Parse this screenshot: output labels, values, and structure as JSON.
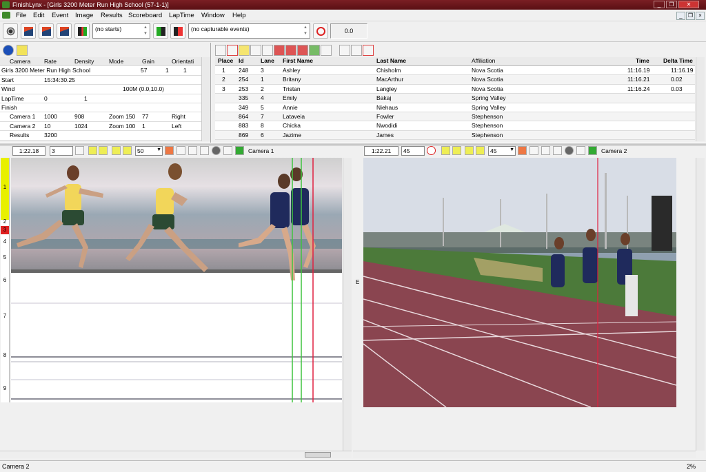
{
  "window": {
    "title": "FinishLynx - [Girls 3200 Meter Run High School (57-1-1)]"
  },
  "menu": [
    "File",
    "Edit",
    "Event",
    "Image",
    "Results",
    "Scoreboard",
    "LapTime",
    "Window",
    "Help"
  ],
  "toolbar": {
    "start_combo": "(no starts)",
    "event_combo": "(no capturable events)",
    "time_display": "0.0"
  },
  "info": {
    "headers": [
      "Camera",
      "Rate",
      "Density",
      "Mode",
      "Gain",
      "Orientati"
    ],
    "event_name": "Girls 3200 Meter Run High School",
    "event_nums": [
      "57",
      "1",
      "1"
    ],
    "start_label": "Start",
    "start_value": "15:34:30.25",
    "wind_label": "Wind",
    "wind_value": "100M (0.0,10.0)",
    "laptime_label": "LapTime",
    "laptime_values": [
      "0",
      "1"
    ],
    "finish_label": "Finish",
    "cameras": [
      {
        "name": "Camera 1",
        "rate": "1000",
        "density": "908",
        "mode": "Zoom 150",
        "gain": "77",
        "orientation": "Right"
      },
      {
        "name": "Camera 2",
        "rate": "10",
        "density": "1024",
        "mode": "Zoom 100",
        "gain": "1",
        "orientation": "Left"
      }
    ],
    "results_label": "Results",
    "results_value": "3200"
  },
  "results": {
    "headers": {
      "place": "Place",
      "id": "Id",
      "lane": "Lane",
      "first": "First Name",
      "last": "Last Name",
      "aff": "Affiliation",
      "time": "Time",
      "delta": "Delta Time"
    },
    "rows": [
      {
        "place": "1",
        "id": "248",
        "lane": "3",
        "first": "Ashley",
        "last": "Chisholm",
        "aff": "Nova Scotia",
        "time": "11:16.19",
        "delta": "11:16.19"
      },
      {
        "place": "2",
        "id": "254",
        "lane": "1",
        "first": "Britany",
        "last": "MacArthur",
        "aff": "Nova Scotia",
        "time": "11:16.21",
        "delta": "0.02"
      },
      {
        "place": "3",
        "id": "253",
        "lane": "2",
        "first": "Tristan",
        "last": "Langley",
        "aff": "Nova Scotia",
        "time": "11:16.24",
        "delta": "0.03"
      },
      {
        "place": "",
        "id": "335",
        "lane": "4",
        "first": "Emily",
        "last": "Bakaj",
        "aff": "Spring Valley",
        "time": "",
        "delta": ""
      },
      {
        "place": "",
        "id": "349",
        "lane": "5",
        "first": "Annie",
        "last": "Niehaus",
        "aff": "Spring Valley",
        "time": "",
        "delta": ""
      },
      {
        "place": "",
        "id": "864",
        "lane": "7",
        "first": "Lataveia",
        "last": "Fowler",
        "aff": "Stephenson",
        "time": "",
        "delta": ""
      },
      {
        "place": "",
        "id": "883",
        "lane": "8",
        "first": "Chicka",
        "last": "Nwodidi",
        "aff": "Stephenson",
        "time": "",
        "delta": ""
      },
      {
        "place": "",
        "id": "869",
        "lane": "6",
        "first": "Jazime",
        "last": "James",
        "aff": "Stephenson",
        "time": "",
        "delta": ""
      }
    ]
  },
  "cam1": {
    "time": "1:22.18",
    "frame": "3",
    "zoom": "50",
    "label": "Camera 1",
    "lanes": [
      "1",
      "2",
      "3",
      "4",
      "5",
      "6",
      "7",
      "8",
      "9"
    ]
  },
  "cam2": {
    "time": "1:22.21",
    "frame": "45",
    "zoom": "45",
    "label": "Camera 2",
    "edge_label": "E"
  },
  "status": {
    "left": "Camera 2",
    "right": "2%"
  },
  "colors": {
    "titlebar": "#7a1f24",
    "lane_yellow": "#e8f000",
    "lane_red": "#e02020",
    "track": "#8a4550",
    "grass": "#4c7a3a",
    "sky": "#d8dde6"
  }
}
